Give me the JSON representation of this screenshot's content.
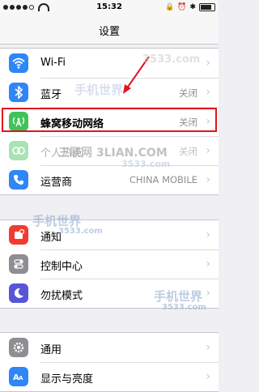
{
  "status": {
    "time": "15:32"
  },
  "nav": {
    "title": "设置"
  },
  "group1": [
    {
      "label": "Wi-Fi",
      "value": "",
      "icon": "wifi-icon",
      "color": "#2f86f6"
    },
    {
      "label": "蓝牙",
      "value": "关闭",
      "icon": "bluetooth-icon",
      "color": "#2f86f6"
    },
    {
      "label": "蜂窝移动网络",
      "value": "关闭",
      "icon": "cellular-icon",
      "color": "#3fc359"
    },
    {
      "label": "个人热点",
      "value": "关闭",
      "icon": "hotspot-icon",
      "color": "#3fc359"
    },
    {
      "label": "运营商",
      "value": "CHINA MOBILE",
      "icon": "carrier-phone-icon",
      "color": "#2f86f6"
    }
  ],
  "group2": [
    {
      "label": "通知",
      "value": "",
      "icon": "notifications-icon",
      "color": "#f23b30"
    },
    {
      "label": "控制中心",
      "value": "",
      "icon": "control-center-icon",
      "color": "#8e8e93"
    },
    {
      "label": "勿扰模式",
      "value": "",
      "icon": "do-not-disturb-moon-icon",
      "color": "#5856d6"
    }
  ],
  "group3": [
    {
      "label": "通用",
      "value": "",
      "icon": "gear-icon",
      "color": "#8e8e93"
    },
    {
      "label": "显示与亮度",
      "value": "",
      "icon": "display-brightness-icon",
      "color": "#2f86f6"
    }
  ],
  "watermarks": {
    "top_right": "3533.com",
    "middle": "三联网 3LIAN.COM",
    "brand": "手机世界",
    "domain": "3533.com"
  },
  "highlight_color": "#e0151e"
}
